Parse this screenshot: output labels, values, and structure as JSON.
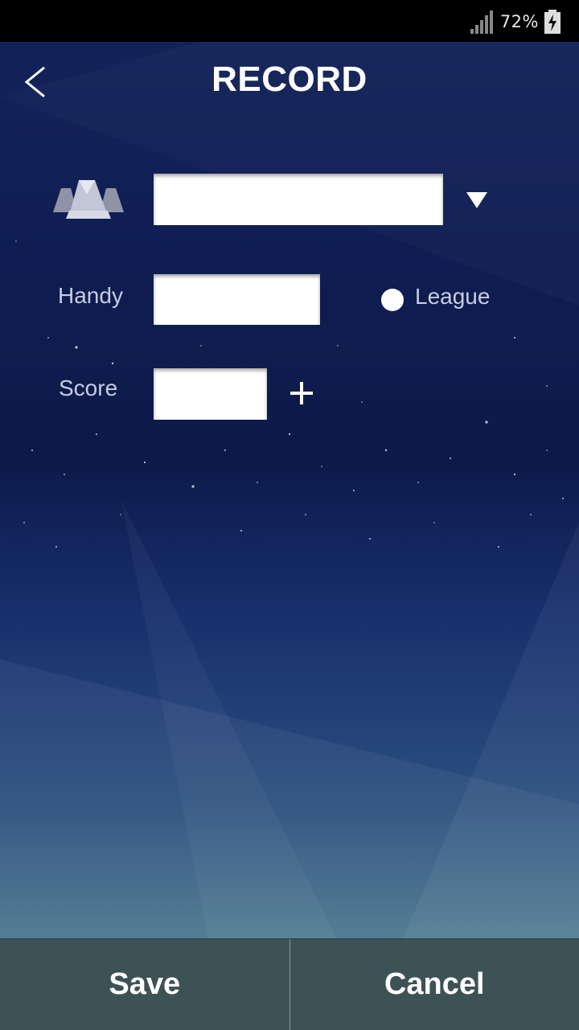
{
  "status_bar": {
    "battery_percent": "72%",
    "icons": [
      "signal-icon",
      "battery-charging-icon"
    ]
  },
  "header": {
    "title": "RECORD",
    "back_icon": "chevron-left-icon"
  },
  "form": {
    "player_icon": "players-icon",
    "name_value": "",
    "dropdown_icon": "triangle-down-icon",
    "handy_label": "Handy",
    "handy_value": "",
    "league_label": "League",
    "league_selected": false,
    "score_label": "Score",
    "score_value": "",
    "add_icon": "plus-icon"
  },
  "actions": {
    "save_label": "Save",
    "cancel_label": "Cancel"
  },
  "colors": {
    "bottom_bar": "#3d5257",
    "background_top": "#14245a",
    "background_bottom": "#6a98a3"
  }
}
